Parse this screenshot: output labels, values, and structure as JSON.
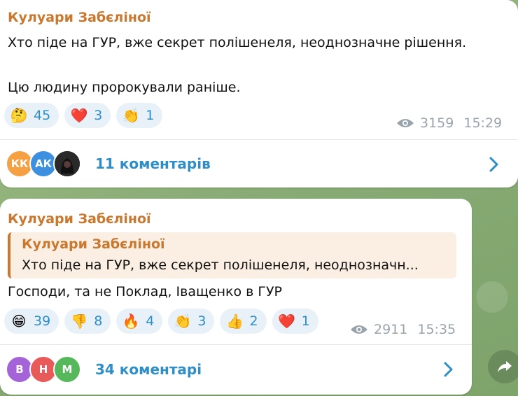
{
  "messages": [
    {
      "sender": "Кулуари Забєліної",
      "lines": [
        "Хто піде на ГУР, вже секрет полішенеля, неоднозначне рішення.",
        "Цю людину пророкували раніше."
      ],
      "reactions": [
        {
          "emoji": "🤔",
          "icon": "thinking-face-icon",
          "count": "45"
        },
        {
          "emoji": "❤️",
          "icon": "red-heart-icon",
          "count": "3"
        },
        {
          "emoji": "👏",
          "icon": "clapping-hands-icon",
          "count": "1"
        }
      ],
      "views": "3159",
      "time": "15:29",
      "comments": {
        "avatars": [
          {
            "initials": "КК",
            "color": "#f5a043"
          },
          {
            "initials": "АК",
            "color": "#3d8fe0"
          },
          {
            "initials": "",
            "color": "#2a2a2a"
          }
        ],
        "label": "11 коментарів"
      }
    },
    {
      "sender": "Кулуари Забєліної",
      "reply": {
        "name": "Кулуари Забєліної",
        "text": "Хто піде на ГУР, вже секрет полішенеля, неоднозначн..."
      },
      "lines": [
        "Господи, та не Поклад, Іващенко в ГУР"
      ],
      "reactions": [
        {
          "emoji": "😁",
          "icon": "grinning-face-icon",
          "count": "39"
        },
        {
          "emoji": "👎",
          "icon": "thumbs-down-icon",
          "count": "8"
        },
        {
          "emoji": "🔥",
          "icon": "fire-icon",
          "count": "4"
        },
        {
          "emoji": "👏",
          "icon": "clapping-hands-icon",
          "count": "3"
        },
        {
          "emoji": "👍",
          "icon": "thumbs-up-icon",
          "count": "2"
        },
        {
          "emoji": "❤️",
          "icon": "red-heart-icon",
          "count": "1"
        }
      ],
      "views": "2911",
      "time": "15:35",
      "comments": {
        "avatars": [
          {
            "initials": "В",
            "color": "#a463d6"
          },
          {
            "initials": "Н",
            "color": "#e8595a"
          },
          {
            "initials": "М",
            "color": "#56b85a"
          }
        ],
        "label": "34 коментарі"
      }
    }
  ],
  "colors": {
    "sender": "#c8782f",
    "accent": "#2d8ec8",
    "reaction_bg": "#e8f1f8",
    "meta": "#9aa4ad"
  }
}
